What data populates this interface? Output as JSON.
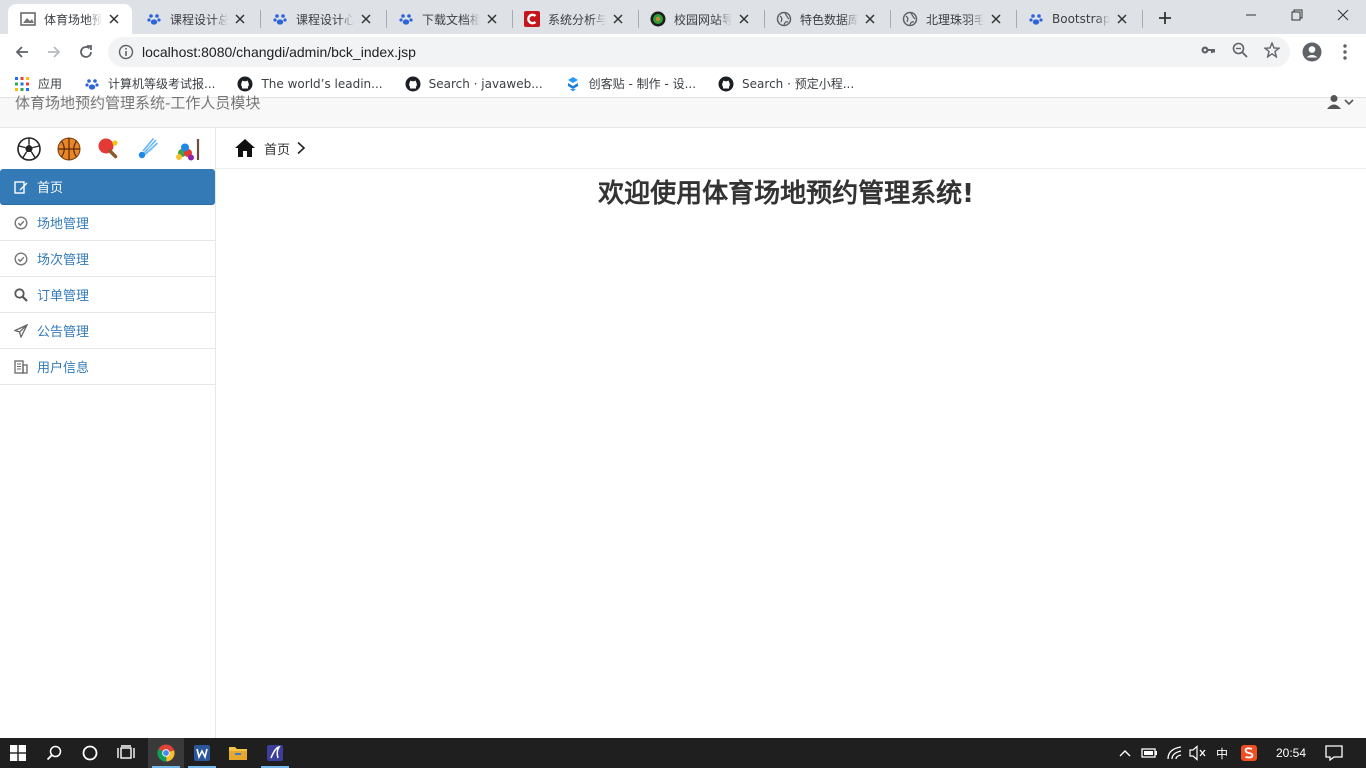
{
  "browser": {
    "tabs": [
      {
        "title": "体育场地预约",
        "icon": "image-favicon",
        "active": true
      },
      {
        "title": "课程设计总结",
        "icon": "baidu-paw-icon"
      },
      {
        "title": "课程设计心得",
        "icon": "baidu-paw-icon"
      },
      {
        "title": "下载文档相关",
        "icon": "baidu-paw-icon"
      },
      {
        "title": "系统分析与设计",
        "icon": "c-red-icon"
      },
      {
        "title": "校园网站导航",
        "icon": "green-circle-icon"
      },
      {
        "title": "特色数据库",
        "icon": "globe-icon"
      },
      {
        "title": "北理珠羽毛球",
        "icon": "globe-icon"
      },
      {
        "title": "Bootstrap",
        "icon": "baidu-paw-icon"
      }
    ],
    "url": "localhost:8080/changdi/admin/bck_index.jsp",
    "bookmarks": [
      {
        "label": "应用",
        "icon": "apps-grid-icon"
      },
      {
        "label": "计算机等级考试报...",
        "icon": "baidu-paw-icon"
      },
      {
        "label": "The world’s leadin...",
        "icon": "github-icon"
      },
      {
        "label": "Search · javaweb...",
        "icon": "github-icon"
      },
      {
        "label": "创客贴 - 制作 - 设...",
        "icon": "chuangkit-icon"
      },
      {
        "label": "Search · 预定小程...",
        "icon": "github-icon"
      }
    ]
  },
  "app": {
    "brand": "体育场地预约管理系统-工作人员模块",
    "breadcrumb": {
      "home": "首页"
    },
    "welcome": "欢迎使用体育场地预约管理系统!",
    "sports": [
      "soccer-ball-icon",
      "basketball-icon",
      "ping-pong-icon",
      "badminton-icon",
      "billiards-icon"
    ],
    "menu": [
      {
        "label": "首页",
        "icon": "edit-icon",
        "active": true
      },
      {
        "label": "场地管理",
        "icon": "check-circle-icon"
      },
      {
        "label": "场次管理",
        "icon": "check-circle-icon"
      },
      {
        "label": "订单管理",
        "icon": "search-icon"
      },
      {
        "label": "公告管理",
        "icon": "send-icon"
      },
      {
        "label": "用户信息",
        "icon": "building-icon"
      }
    ],
    "colors": {
      "primary": "#337ab7",
      "link": "#337ab7"
    }
  },
  "taskbar": {
    "clock": "20:54",
    "ime": "中"
  }
}
